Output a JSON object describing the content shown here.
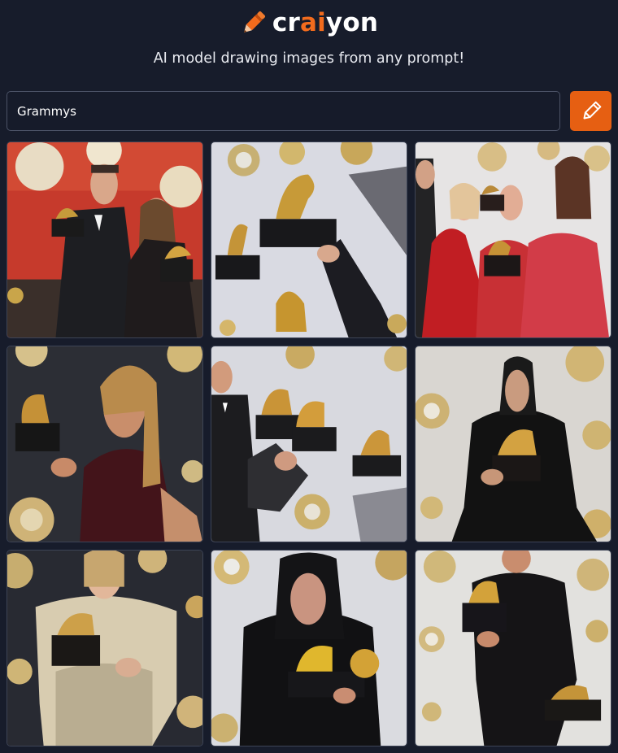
{
  "app": {
    "logo_prefix": "cr",
    "logo_accent": "ai",
    "logo_suffix": "yon",
    "tagline": "AI model drawing images from any prompt!"
  },
  "search": {
    "value": "Grammys"
  },
  "colors": {
    "background": "#171c2b",
    "accent": "#e65f12",
    "input_border": "#4b5266"
  },
  "icons": {
    "logo": "pencil-icon",
    "draw_button": "pencil-icon"
  },
  "gallery": {
    "images": [
      {
        "subject": "tuxedo man and woman holding gramophone trophy, red backdrop"
      },
      {
        "subject": "gramophone trophies floating, hand in black sleeve"
      },
      {
        "subject": "three women in red gowns with trophy"
      },
      {
        "subject": "woman in dark red dress holding gramophone trophy"
      },
      {
        "subject": "man in tuxedo holding several gramophone trophies"
      },
      {
        "subject": "woman in black dress holding gold trophy"
      },
      {
        "subject": "woman in sequined dress holding trophy"
      },
      {
        "subject": "person in black hoodie holding gold trophies"
      },
      {
        "subject": "man in black suit holding trophies"
      }
    ]
  }
}
